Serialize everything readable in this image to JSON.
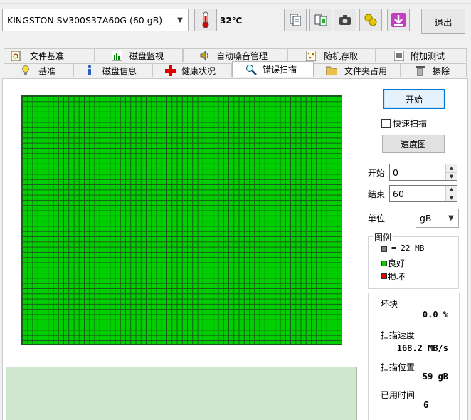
{
  "toolbar": {
    "drive": "KINGSTON SV300S37A60G (60 gB)",
    "temperature": "32℃",
    "exit_label": "退出",
    "icons": [
      "copy-icon",
      "compare-icon",
      "camera-icon",
      "health-icon",
      "download-icon"
    ]
  },
  "tabs": {
    "row1": [
      {
        "label": "文件基准",
        "icon": "file-benchmark-icon"
      },
      {
        "label": "磁盘监视",
        "icon": "chart-icon"
      },
      {
        "label": "自动噪音管理",
        "icon": "speaker-icon"
      },
      {
        "label": "随机存取",
        "icon": "dots-icon"
      },
      {
        "label": "附加测试",
        "icon": "extra-test-icon"
      }
    ],
    "row2": [
      {
        "label": "基准",
        "icon": "lightbulb-icon"
      },
      {
        "label": "磁盘信息",
        "icon": "info-icon"
      },
      {
        "label": "健康状况",
        "icon": "red-cross-icon"
      },
      {
        "label": "错误扫描",
        "icon": "magnifier-icon",
        "active": true
      },
      {
        "label": "文件夹占用",
        "icon": "folder-icon"
      },
      {
        "label": "擦除",
        "icon": "trash-icon"
      }
    ]
  },
  "controls": {
    "start_button": "开始",
    "quick_scan": "快速扫描",
    "quick_scan_checked": false,
    "speed_map": "速度图",
    "start_label": "开始",
    "start_value": "0",
    "end_label": "结束",
    "end_value": "60",
    "unit_label": "单位",
    "unit_value": "gB"
  },
  "legend": {
    "title": "图例",
    "block_size": "= 22 MB",
    "good": "良好",
    "bad": "损坏",
    "colors": {
      "block": "#7f7f7f",
      "good": "#00d000",
      "bad": "#e00000"
    }
  },
  "stats": {
    "bad_blocks_label": "坏块",
    "bad_blocks_value": "0.0 %",
    "scan_speed_label": "扫描速度",
    "scan_speed_value": "168.2 MB/s",
    "scan_position_label": "扫描位置",
    "scan_position_value": "59 gB",
    "elapsed_label": "已用时间",
    "elapsed_value": "6"
  }
}
